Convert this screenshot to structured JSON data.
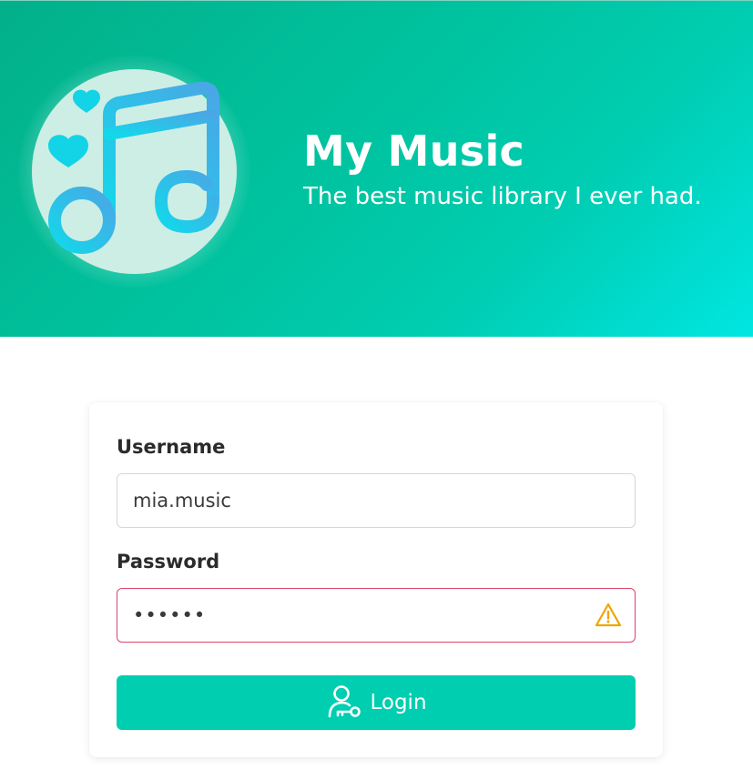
{
  "header": {
    "app_title": "My Music",
    "tagline": "The best music library I ever had.",
    "logo_icon": "music-note-hearts-icon"
  },
  "form": {
    "username_label": "Username",
    "username_value": "mia.music",
    "password_label": "Password",
    "password_value": "••••••",
    "password_warning_icon": "warning-triangle-icon",
    "login_label": "Login",
    "login_icon": "user-key-icon"
  },
  "colors": {
    "accent": "#00ceb0",
    "header_gradient_start": "#02b08a",
    "header_gradient_end": "#00e6e2",
    "error_border": "#d9466b",
    "warning": "#f0a500"
  }
}
